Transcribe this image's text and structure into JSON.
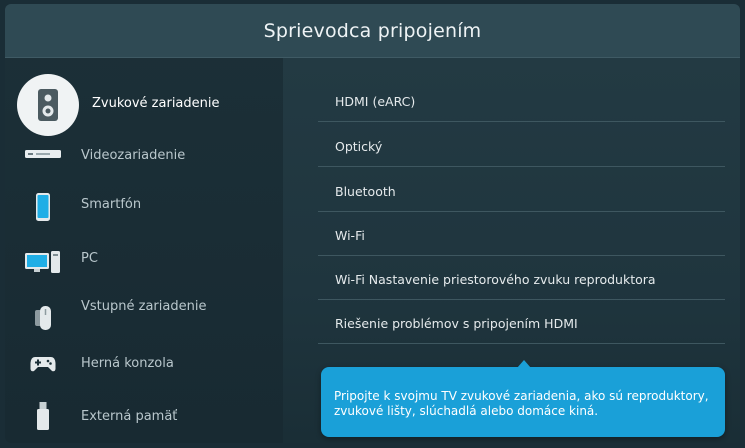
{
  "title": "Sprievodca pripojením",
  "sidebar": {
    "items": [
      {
        "label": "Zvukové zariadenie",
        "icon": "speaker-icon",
        "active": true
      },
      {
        "label": "Videozariadenie",
        "icon": "video-device-icon"
      },
      {
        "label": "Smartfón",
        "icon": "smartphone-icon"
      },
      {
        "label": "PC",
        "icon": "pc-icon"
      },
      {
        "label": "Vstupné zariadenie",
        "icon": "input-device-icon"
      },
      {
        "label": "Herná konzola",
        "icon": "game-console-icon"
      },
      {
        "label": "Externá pamäť",
        "icon": "usb-storage-icon"
      }
    ]
  },
  "options": [
    {
      "label": "HDMI (eARC)"
    },
    {
      "label": "Optický"
    },
    {
      "label": "Bluetooth"
    },
    {
      "label": "Wi-Fi"
    },
    {
      "label": "Wi-Fi Nastavenie priestorového zvuku reproduktora"
    },
    {
      "label": "Riešenie problémov s pripojením HDMI"
    }
  ],
  "tooltip": {
    "text": "Pripojte k svojmu TV zvukové zariadenia, ako sú reproduktory, zvukové lišty, slúchadlá alebo domáce kiná."
  },
  "colors": {
    "accent": "#1aa0d8",
    "header": "#2f4a54",
    "background": "#1c3038"
  }
}
